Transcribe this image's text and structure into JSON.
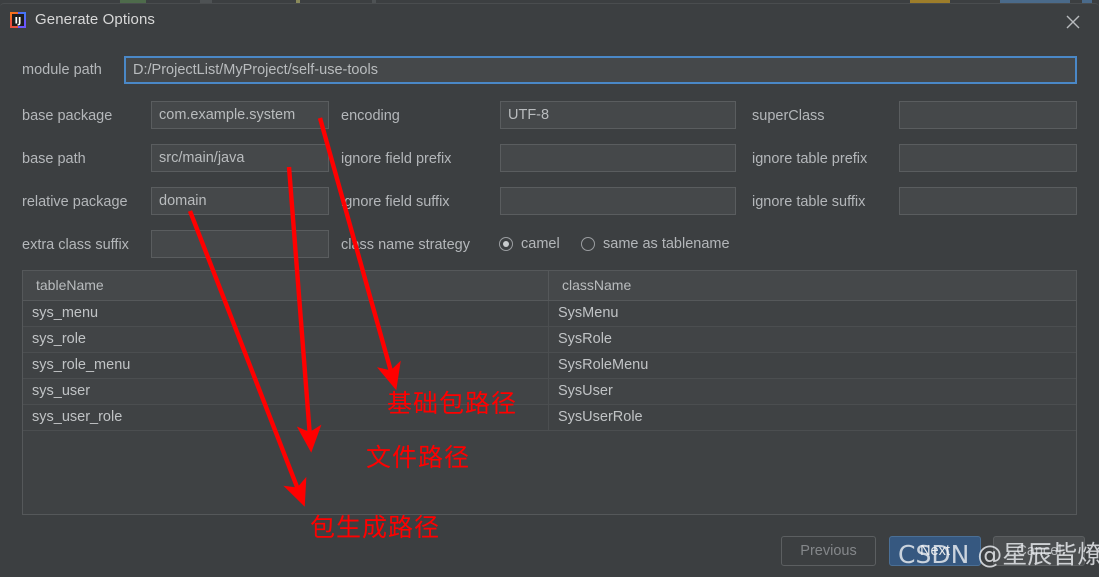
{
  "window": {
    "title": "Generate Options",
    "app_icon": "intellij-idea-icon",
    "close_icon": "close-icon"
  },
  "form": {
    "module_path": {
      "label": "module path",
      "value": "D:/ProjectList/MyProject/self-use-tools",
      "focused": true
    },
    "base_package": {
      "label": "base package",
      "value": "com.example.system"
    },
    "base_path": {
      "label": "base path",
      "value": "src/main/java"
    },
    "relative_package": {
      "label": "relative package",
      "value": "domain"
    },
    "extra_class_suffix": {
      "label": "extra class suffix",
      "value": ""
    },
    "encoding": {
      "label": "encoding",
      "value": "UTF-8"
    },
    "ignore_field_prefix": {
      "label": "ignore field prefix",
      "value": ""
    },
    "ignore_field_suffix": {
      "label": "ignore field suffix",
      "value": ""
    },
    "class_name_strategy": {
      "label": "class name strategy",
      "options": [
        {
          "label": "camel",
          "checked": true
        },
        {
          "label": "same as tablename",
          "checked": false
        }
      ]
    },
    "super_class": {
      "label": "superClass",
      "value": ""
    },
    "ignore_table_prefix": {
      "label": "ignore table prefix",
      "value": ""
    },
    "ignore_table_suffix": {
      "label": "ignore table suffix",
      "value": ""
    }
  },
  "table": {
    "columns": [
      "tableName",
      "className"
    ],
    "rows": [
      {
        "tableName": "sys_menu",
        "className": "SysMenu"
      },
      {
        "tableName": "sys_role",
        "className": "SysRole"
      },
      {
        "tableName": "sys_role_menu",
        "className": "SysRoleMenu"
      },
      {
        "tableName": "sys_user",
        "className": "SysUser"
      },
      {
        "tableName": "sys_user_role",
        "className": "SysUserRole"
      }
    ]
  },
  "footer": {
    "previous": "Previous",
    "next": "Next",
    "cancel": "Cancel"
  },
  "annotations": [
    {
      "text": "基础包路径",
      "note": "base package path"
    },
    {
      "text": "文件路径",
      "note": "file path"
    },
    {
      "text": "包生成路径",
      "note": "package generation path"
    }
  ],
  "watermark": "CSDN @星辰皆燎原",
  "colors": {
    "dialog_bg": "#3c3f41",
    "field_bg": "#45484a",
    "focus_border": "#4a88c7",
    "primary_button": "#365880",
    "annotation_red": "#ff0000",
    "text": "#b4b7ba"
  }
}
